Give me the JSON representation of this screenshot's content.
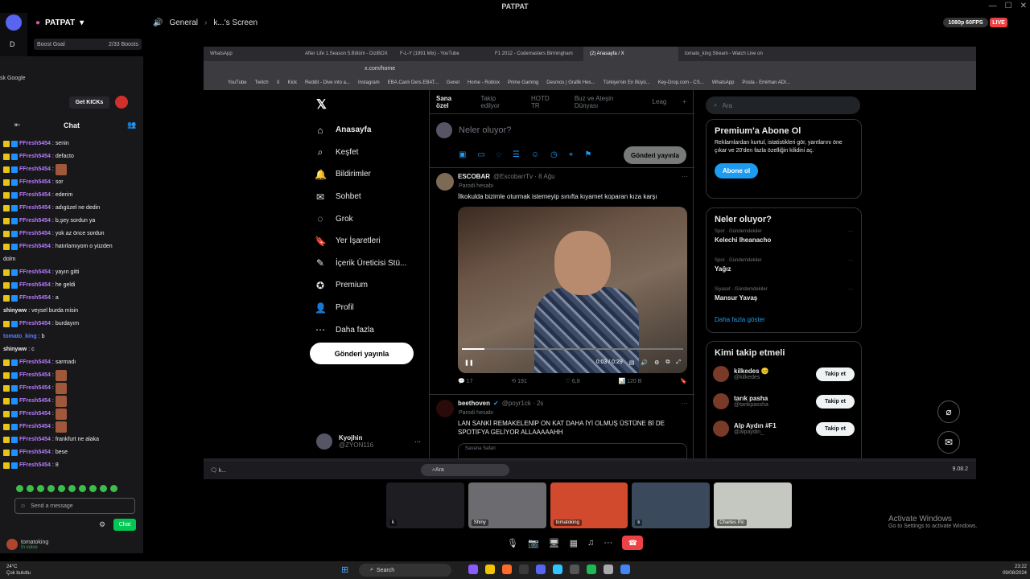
{
  "window": {
    "title": "PATPAT"
  },
  "discord": {
    "server_name": "PATPAT",
    "voice_channel": "General",
    "screen_label": "k...'s Screen",
    "stream_quality": "1080p 60FPS",
    "live_label": "LIVE",
    "left_label": "D"
  },
  "kick": {
    "boost_goal_label": "Boost Goal",
    "boost_goal_value": "2/33 Boosts",
    "browser_tab_label": "sk Google",
    "get_kicks_label": "Get KICKs",
    "chat_title": "Chat",
    "messages": [
      {
        "user": "FFresh5454",
        "text": "senin",
        "badges": true,
        "emote": false
      },
      {
        "user": "FFresh5454",
        "text": "defacto",
        "badges": true,
        "emote": false
      },
      {
        "user": "FFresh5454",
        "text": "",
        "badges": true,
        "emote": true
      },
      {
        "user": "FFresh5454",
        "text": "sor",
        "badges": true,
        "emote": false
      },
      {
        "user": "FFresh5454",
        "text": "ederim",
        "badges": true,
        "emote": false
      },
      {
        "user": "FFresh5454",
        "text": "adıgüzel ne dedin",
        "badges": true,
        "emote": false
      },
      {
        "user": "FFresh5454",
        "text": "b,şey sordun ya",
        "badges": true,
        "emote": false
      },
      {
        "user": "FFresh5454",
        "text": "yok az önce sordun",
        "badges": true,
        "emote": false
      },
      {
        "user": "FFresh5454",
        "text": "hatırlamıyom o yüzden",
        "badges": true,
        "emote": false
      },
      {
        "user": "",
        "text": "dolm",
        "badges": false,
        "emote": false
      },
      {
        "user": "FFresh5454",
        "text": "yayın gitti",
        "badges": true,
        "emote": false
      },
      {
        "user": "FFresh5454",
        "text": "he geldi",
        "badges": true,
        "emote": false
      },
      {
        "user": "FFresh5454",
        "text": "a",
        "badges": true,
        "emote": false
      },
      {
        "user": "shinyww",
        "text": "veysel burda misin",
        "badges": false,
        "emote": false
      },
      {
        "user": "FFresh5454",
        "text": "burdayım",
        "badges": true,
        "emote": false
      },
      {
        "user": "tomato_king",
        "text": "b",
        "badges": false,
        "emote": false
      },
      {
        "user": "shinyww",
        "text": "c",
        "badges": false,
        "emote": false
      },
      {
        "user": "FFresh5454",
        "text": "sarmadı",
        "badges": true,
        "emote": false
      },
      {
        "user": "FFresh5454",
        "text": "",
        "badges": true,
        "emote": true
      },
      {
        "user": "FFresh5454",
        "text": "",
        "badges": true,
        "emote": true
      },
      {
        "user": "FFresh5454",
        "text": "",
        "badges": true,
        "emote": true
      },
      {
        "user": "FFresh5454",
        "text": "",
        "badges": true,
        "emote": true
      },
      {
        "user": "FFresh5454",
        "text": "",
        "badges": true,
        "emote": true
      },
      {
        "user": "FFresh5454",
        "text": "frankfurt ne alaka",
        "badges": true,
        "emote": false
      },
      {
        "user": "FFresh5454",
        "text": "bese",
        "badges": true,
        "emote": false
      },
      {
        "user": "FFresh5454",
        "text": "8",
        "badges": true,
        "emote": false
      }
    ],
    "input_placeholder": "Send a message",
    "chat_button": "Chat",
    "voice_user": "tomatoking",
    "voice_status": "In voice"
  },
  "browser": {
    "tabs": [
      "WhatsApp",
      "After Life 1.Season 5.Bölüm - DiziBOX",
      "F-L-Y (1991 Mix) - YouTube",
      "F1 2012 - Codemasters Birmingham",
      "(2) Anasayfa / X",
      "tomato_king Stream - Watch Live on"
    ],
    "url": "x.com/home",
    "bookmarks": [
      "YouTube",
      "Twitch",
      "X",
      "Kick",
      "Reddit - Dive into a...",
      "Instagram",
      "EBA.Canlı Ders.EBAT...",
      "Genel",
      "Home - Roblox",
      "Prime Gaming",
      "Desmos | Grafik Hes...",
      "Türkiye'nin En Büyü...",
      "Key-Drop.com - CS...",
      "WhatsApp",
      "Posta - Emirhan ADI..."
    ]
  },
  "x": {
    "nav": [
      "Anasayfa",
      "Keşfet",
      "Bildirimler",
      "Sohbet",
      "Grok",
      "Yer İşaretleri",
      "İçerik Üreticisi Stü...",
      "Premium",
      "Profil",
      "Daha fazla"
    ],
    "post_button": "Gönderi yayınla",
    "profile_name": "Kyojhin",
    "profile_handle": "@ZYON116",
    "feed_tabs": [
      "Sana özel",
      "Takip edilyor",
      "HOTD TR",
      "Buz ve Ateşin Dünyası",
      "Leag"
    ],
    "compose_placeholder": "Neler oluyor?",
    "compose_post": "Gönderi yayınla",
    "tweet1": {
      "name": "ESCOBAR",
      "handle": "@EscobarrTv · 8 Ağu",
      "sub": "Parodi hesabı",
      "text": "İlkokulda bizimle oturmak istemeyip sınıfta kıyamet koparan kıza karşı",
      "time": "0:03 / 0:29",
      "progress": 0.1,
      "replies": "17",
      "reposts": "191",
      "likes": "6,8",
      "views": "120 B"
    },
    "tweet2": {
      "name": "beethoven",
      "handle": "@poyr1ck · 2s",
      "sub": "Parodi hesabı",
      "text": "LAN SANKİ REMAKELENİP ON KAT DAHA İYİ OLMUŞ ÜSTÜNE Bİ DE SPOTİFYA GELİYOR ALLAAAAAHH",
      "card_text": "Savana Safari"
    },
    "search_placeholder": "Ara",
    "premium": {
      "title": "Premium'a Abone Ol",
      "body": "Reklamlardan kurtul, istatistikleri gör, yarıtlarını öne çıkar ve 20'den fazla özelliğin kilidini aç.",
      "button": "Abone ol"
    },
    "trends_title": "Neler oluyor?",
    "trends": [
      {
        "category": "Spor · Gündemdekiler",
        "name": "Kelechi Iheanacho"
      },
      {
        "category": "Spor · Gündemdekiler",
        "name": "Yağız"
      },
      {
        "category": "Siyaset · Gündemdekiler",
        "name": "Mansur Yavaş"
      }
    ],
    "trends_more": "Daha fazla göster",
    "follow_title": "Kimi takip etmeli",
    "follow": [
      {
        "name": "kilkedes 😊",
        "handle": "@kilkedes",
        "button": "Takip et"
      },
      {
        "name": "tarık pasha",
        "handle": "@tarikpassha",
        "button": "Takip et"
      },
      {
        "name": "Alp Aydın #F1",
        "handle": "@alpaydin_",
        "button": "Takip et"
      }
    ]
  },
  "inner_taskbar": {
    "search": "Ara",
    "clock": "9.08.2"
  },
  "participants": [
    {
      "label": "k",
      "color": "#1e1e22"
    },
    {
      "label": "Shiny",
      "color": "#6b6b70"
    },
    {
      "label": "tomatoking",
      "color": "#d24a2e"
    },
    {
      "label": "k",
      "color": "#3a4a5c"
    },
    {
      "label": "Charles Pic",
      "color": "#c5c8c0"
    }
  ],
  "activate": {
    "title": "Activate Windows",
    "subtitle": "Go to Settings to activate Windows."
  },
  "taskbar": {
    "temp": "24°C",
    "weather": "Çok bulutlu",
    "search": "Search",
    "time": "23:22",
    "date": "09/08/2024"
  }
}
